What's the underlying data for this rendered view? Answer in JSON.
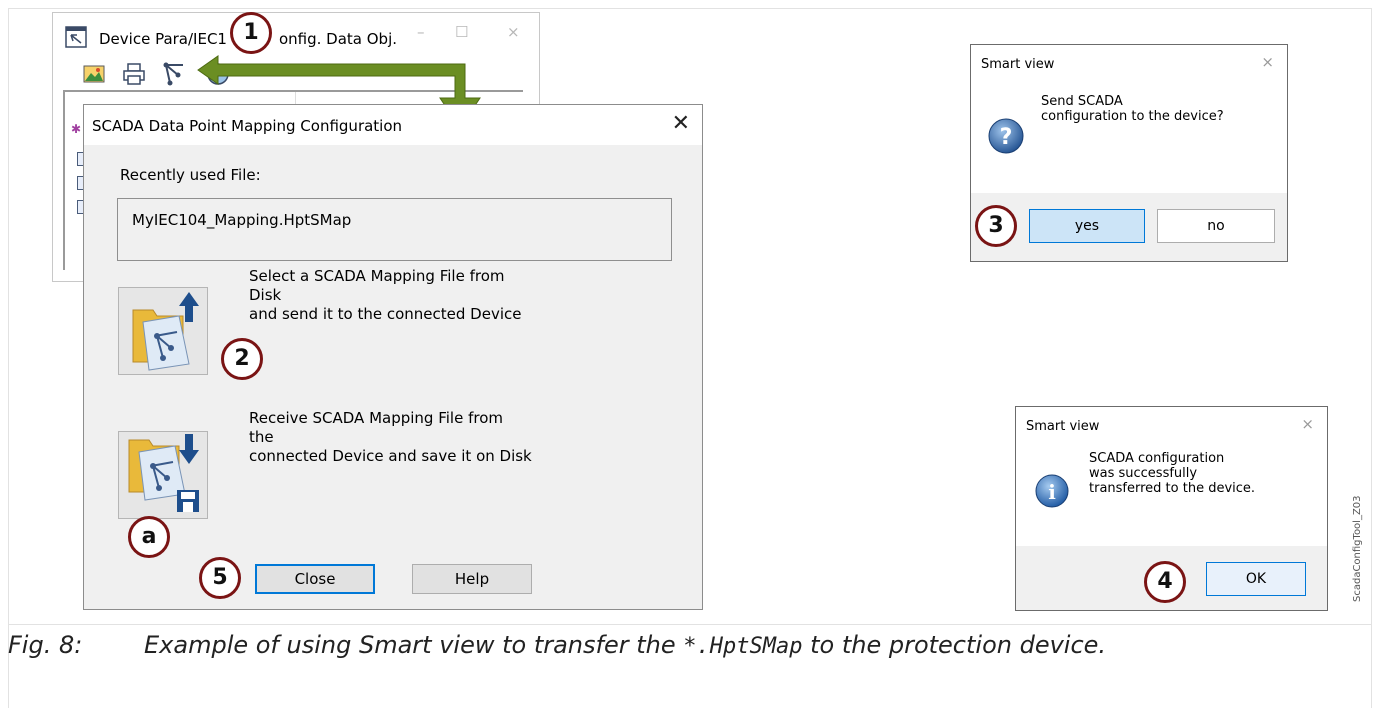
{
  "background_window": {
    "title": "Device Para/IEC104/Config. Data Obj.",
    "title_visible": "Device Para/IEC1",
    "title_tail": "onfig. Data Obj.",
    "minimize": "–",
    "maximize": "☐",
    "close": "×"
  },
  "dialog": {
    "title": "SCADA Data Point Mapping Configuration",
    "close": "✕",
    "recent_label": "Recently used File:",
    "recent_file": "MyIEC104_Mapping.HptSMap",
    "send_text": "Select a SCADA Mapping File from\nDisk\nand send it to the connected Device",
    "receive_text": "Receive SCADA Mapping File from\nthe\nconnected Device and save it on Disk",
    "close_button": "Close",
    "help_button": "Help"
  },
  "confirm_box": {
    "title": "Smart view",
    "close": "×",
    "message": "Send SCADA\nconfiguration to the device?",
    "yes": "yes",
    "no": "no",
    "icon": "question-icon"
  },
  "info_box": {
    "title": "Smart view",
    "close": "×",
    "message": "SCADA configuration\nwas successfully\ntransferred to the device.",
    "ok": "OK",
    "icon": "info-icon"
  },
  "callouts": {
    "c1": "1",
    "c2": "2",
    "c3": "3",
    "c4": "4",
    "c5": "5",
    "ca": "a"
  },
  "caption": {
    "number": "Fig. 8:",
    "text_before": "Example of using Smart view to transfer the ",
    "code": "*.HptSMap",
    "text_after": " to the protection device."
  },
  "figure_id": "ScadaConfigTool_Z03",
  "colors": {
    "arrow": "#6b8e23",
    "callout_border": "#7a1414",
    "default_button_border": "#0078d7",
    "selected_button_bg": "#cce4f7"
  }
}
